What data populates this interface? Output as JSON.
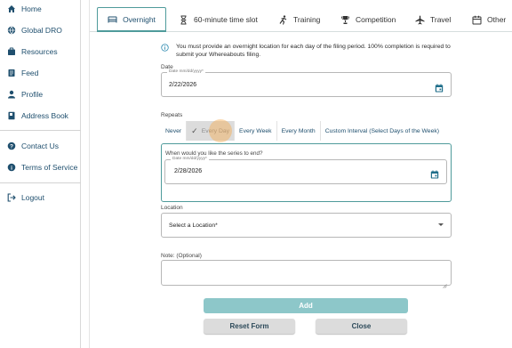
{
  "sidebar": {
    "items": [
      {
        "label": "Home",
        "icon": "home-icon"
      },
      {
        "label": "Global DRO",
        "icon": "globe-icon"
      },
      {
        "label": "Resources",
        "icon": "resources-icon"
      },
      {
        "label": "Feed",
        "icon": "feed-icon"
      },
      {
        "label": "Profile",
        "icon": "profile-icon"
      },
      {
        "label": "Address Book",
        "icon": "address-book-icon"
      },
      {
        "label": "Contact Us",
        "icon": "help-icon"
      },
      {
        "label": "Terms of Service",
        "icon": "info-icon"
      },
      {
        "label": "Logout",
        "icon": "logout-icon"
      }
    ]
  },
  "tabs": [
    {
      "label": "Overnight",
      "icon": "bed-icon",
      "active": true
    },
    {
      "label": "60-minute time slot",
      "icon": "hourglass-icon",
      "active": false
    },
    {
      "label": "Training",
      "icon": "running-icon",
      "active": false
    },
    {
      "label": "Competition",
      "icon": "trophy-icon",
      "active": false
    },
    {
      "label": "Travel",
      "icon": "plane-icon",
      "active": false
    },
    {
      "label": "Other",
      "icon": "calendar-icon",
      "active": false
    }
  ],
  "notice": "You must provide an overnight location for each day of the filing period. 100% completion is required to submit your Whereabouts filing.",
  "date": {
    "label": "Date",
    "legend": "Date mm/dd/yyyy*",
    "value": "2/22/2026"
  },
  "repeats": {
    "label": "Repeats",
    "options": [
      "Never",
      "Every Day",
      "Every Week",
      "Every Month",
      "Custom Interval (Select Days of the Week)"
    ],
    "selected": "Every Day",
    "check": "✓"
  },
  "series_end": {
    "question": "When would you like the series to end?",
    "legend": "Date mm/dd/yyyy*",
    "value": "2/28/2026"
  },
  "location": {
    "label": "Location",
    "placeholder": "Select a Location*"
  },
  "note": {
    "label": "Note: (Optional)"
  },
  "buttons": {
    "add": "Add",
    "reset": "Reset Form",
    "close": "Close"
  },
  "colors": {
    "accent": "#4f9b9b",
    "nav_text": "#1f4f6e",
    "add_button": "#8dc7c9",
    "selected_option": "#dcdcdc"
  }
}
